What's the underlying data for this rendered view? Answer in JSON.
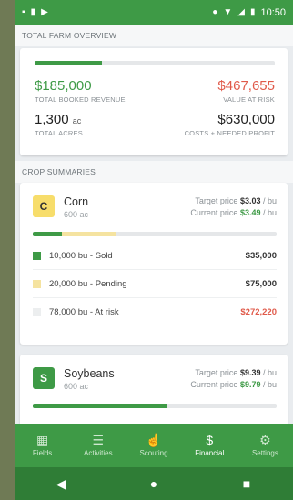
{
  "statusbar": {
    "time": "10:50",
    "left_icons": [
      "carrier-icon",
      "sim-icon",
      "play-icon"
    ]
  },
  "overview": {
    "section_title": "TOTAL FARM OVERVIEW",
    "progress_fraction": 0.28,
    "revenue": "$185,000",
    "revenue_label": "TOTAL BOOKED REVENUE",
    "risk": "$467,655",
    "risk_label": "VALUE AT RISK",
    "acres": "1,300",
    "acres_unit": "ac",
    "acres_label": "TOTAL ACRES",
    "costs": "$630,000",
    "costs_label": "COSTS + NEEDED PROFIT"
  },
  "crops_section_title": "CROP SUMMARIES",
  "corn": {
    "badge": "C",
    "name": "Corn",
    "acres": "600 ac",
    "target_label": "Target price",
    "target_value": "$3.03",
    "current_label": "Current price",
    "current_value": "$3.49",
    "per_unit": "/ bu",
    "sold_fraction": 0.12,
    "pending_fraction": 0.22,
    "rows": [
      {
        "label": "10,000 bu - Sold",
        "amount": "$35,000",
        "color": "#3e9a46"
      },
      {
        "label": "20,000 bu - Pending",
        "amount": "$75,000",
        "color": "#f5e3a0"
      },
      {
        "label": "78,000 bu - At risk",
        "amount": "$272,220",
        "color": "#eceeef"
      }
    ]
  },
  "soybeans": {
    "badge": "S",
    "name": "Soybeans",
    "acres": "600 ac",
    "target_label": "Target price",
    "target_value": "$9.39",
    "current_label": "Current price",
    "current_value": "$9.79",
    "per_unit": "/ bu",
    "sold_fraction": 0.55
  },
  "nav": [
    {
      "label": "Fields",
      "icon": "fields-icon"
    },
    {
      "label": "Activities",
      "icon": "activities-icon"
    },
    {
      "label": "Scouting",
      "icon": "scouting-icon"
    },
    {
      "label": "Financial",
      "icon": "financial-icon"
    },
    {
      "label": "Settings",
      "icon": "settings-icon"
    }
  ],
  "colors": {
    "brand": "#3e9a46",
    "danger": "#e05a4a",
    "pending": "#f5e3a0"
  }
}
